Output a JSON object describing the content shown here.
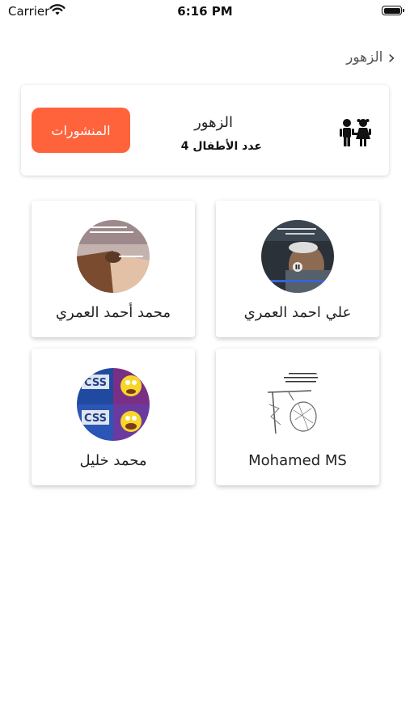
{
  "status_bar": {
    "carrier": "Carrier",
    "time": "6:16 PM"
  },
  "nav": {
    "title": "الزهور",
    "back_icon": "chevron-left-icon"
  },
  "class_card": {
    "name": "الزهور",
    "kids_count": "عدد الأطفال 4",
    "posts_button": "المنشورات",
    "accent_color": "#fe633c",
    "icon": "children-icon"
  },
  "children": [
    {
      "name": "علي احمد العمري",
      "avatar": "video-frame-avatar"
    },
    {
      "name": "محمد أحمد العمري",
      "avatar": "meme-avatar"
    },
    {
      "name": "Mohamed MS",
      "avatar": "sketch-avatar"
    },
    {
      "name": "محمد خليل",
      "avatar": "css-cartoon-avatar"
    }
  ]
}
